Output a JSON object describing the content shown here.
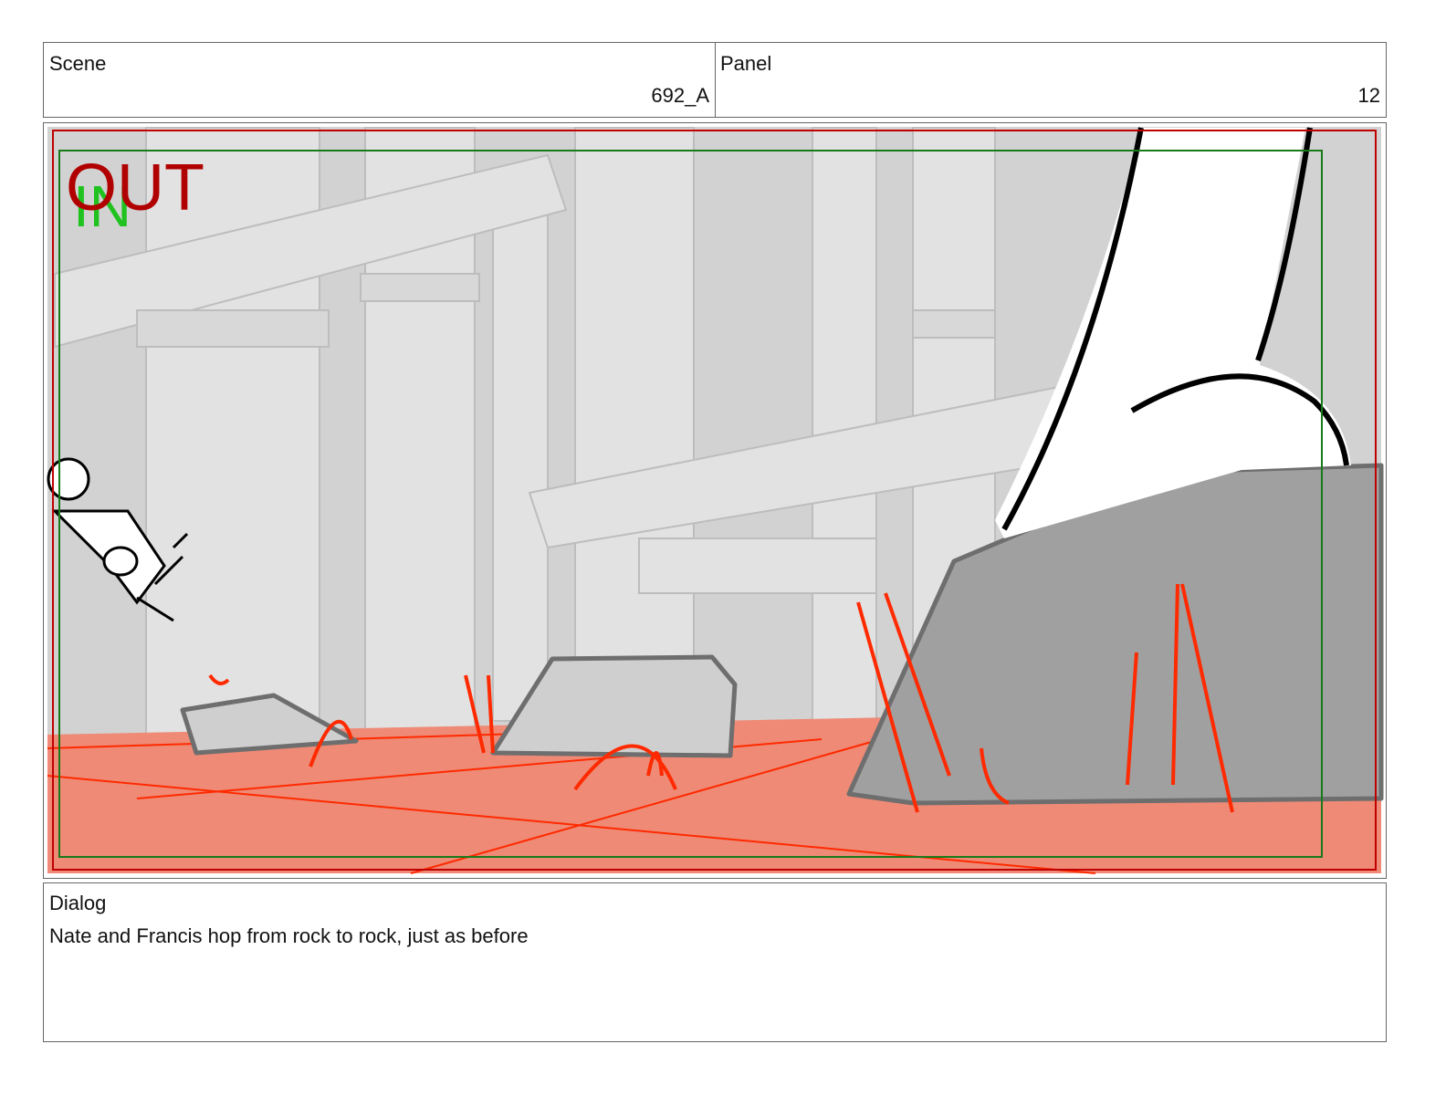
{
  "header": {
    "scene_label": "Scene",
    "scene_value": "692_A",
    "panel_label": "Panel",
    "panel_value": "12"
  },
  "frame": {
    "out_marker": "OUT",
    "in_marker": "IN",
    "colors": {
      "out": "#b00000",
      "in": "#1fc21f",
      "safe_frame": "#1a7a1a",
      "floor": "#ee8a76",
      "sketch_red": "#ff2a00",
      "rock": "#a0a0a0",
      "background": "#d4d4d4"
    }
  },
  "dialog": {
    "label": "Dialog",
    "text": "Nate and Francis hop from rock to rock, just as before"
  }
}
